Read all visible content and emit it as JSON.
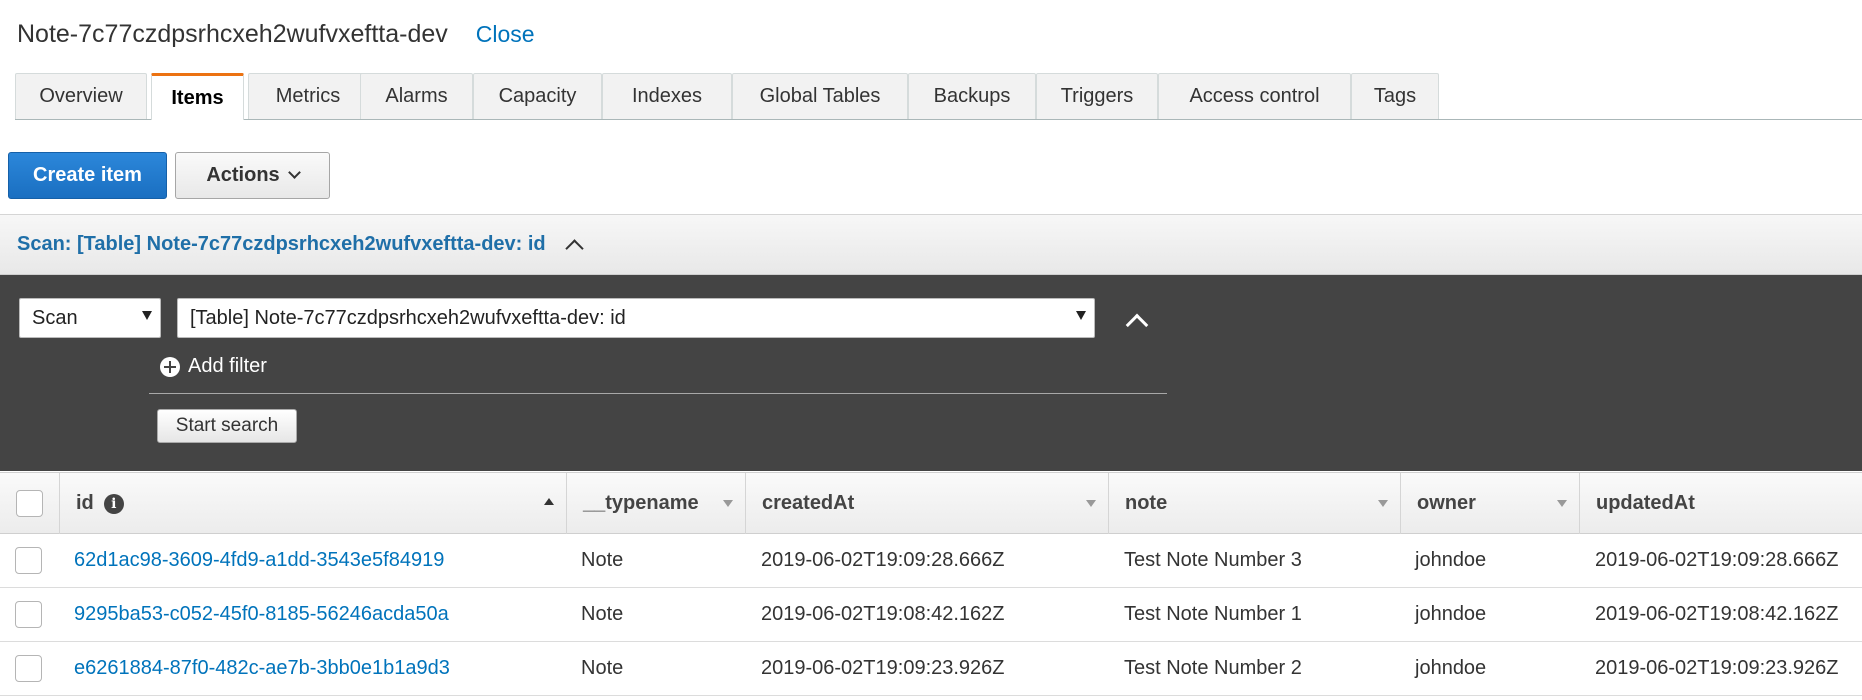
{
  "header": {
    "table_name": "Note-7c77czdpsrhcxeh2wufvxeftta-dev",
    "close_label": "Close"
  },
  "tabs": [
    {
      "label": "Overview",
      "active": false
    },
    {
      "label": "Items",
      "active": true
    },
    {
      "label": "Metrics",
      "active": false
    },
    {
      "label": "Alarms",
      "active": false
    },
    {
      "label": "Capacity",
      "active": false
    },
    {
      "label": "Indexes",
      "active": false
    },
    {
      "label": "Global Tables",
      "active": false
    },
    {
      "label": "Backups",
      "active": false
    },
    {
      "label": "Triggers",
      "active": false
    },
    {
      "label": "Access control",
      "active": false
    },
    {
      "label": "Tags",
      "active": false
    }
  ],
  "toolbar": {
    "create_label": "Create item",
    "actions_label": "Actions"
  },
  "scan": {
    "header_text": "Scan: [Table] Note-7c77czdpsrhcxeh2wufvxeftta-dev: id",
    "mode_value": "Scan",
    "target_value": "[Table] Note-7c77czdpsrhcxeh2wufvxeftta-dev: id",
    "add_filter_label": "Add filter",
    "start_search_label": "Start search"
  },
  "table": {
    "columns": [
      "id",
      "__typename",
      "createdAt",
      "note",
      "owner",
      "updatedAt"
    ],
    "rows": [
      [
        "62d1ac98-3609-4fd9-a1dd-3543e5f84919",
        "Note",
        "2019-06-02T19:09:28.666Z",
        "Test Note Number 3",
        "johndoe",
        "2019-06-02T19:09:28.666Z"
      ],
      [
        "9295ba53-c052-45f0-8185-56246acda50a",
        "Note",
        "2019-06-02T19:08:42.162Z",
        "Test Note Number 1",
        "johndoe",
        "2019-06-02T19:08:42.162Z"
      ],
      [
        "e6261884-87f0-482c-ae7b-3bb0e1b1a9d3",
        "Note",
        "2019-06-02T19:09:23.926Z",
        "Test Note Number 2",
        "johndoe",
        "2019-06-02T19:09:23.926Z"
      ]
    ]
  },
  "colors": {
    "link": "#0073bb",
    "primary": "#1a6fc1",
    "active_tab": "#ec7211",
    "panel": "#444444"
  }
}
